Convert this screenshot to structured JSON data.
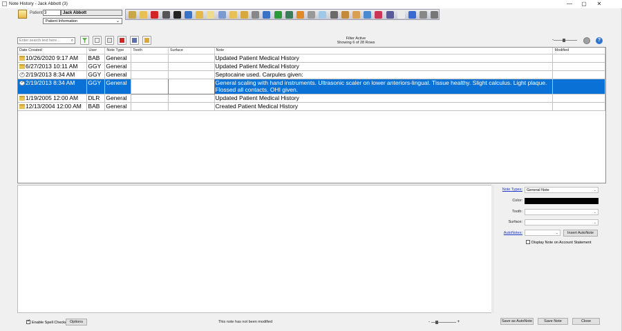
{
  "window": {
    "title": "Note History - Jack Abbott (3)",
    "min_icon": "—",
    "max_icon": "▢",
    "close_icon": "✕"
  },
  "patient": {
    "label": "Patient:",
    "number": "3",
    "name": "Jack Abbott",
    "info_select": "Patient Information"
  },
  "toolbar": {
    "icons": [
      "edit",
      "note",
      "medical-cross",
      "printer",
      "rx",
      "bottle",
      "folder",
      "envelope",
      "chart",
      "docs",
      "folder-open",
      "box",
      "stamp",
      "arrows",
      "chart2",
      "pill",
      "clipboard",
      "tooth",
      "instrument",
      "pen",
      "tool",
      "brush",
      "drawing",
      "phone",
      "camera",
      "xray",
      "wrench",
      "camera2"
    ]
  },
  "search": {
    "placeholder": "Enter search text here..."
  },
  "filter": {
    "line1": "Filter Active",
    "line2": "Showing 6 of 28 Rows"
  },
  "grid": {
    "columns": [
      "Date Created",
      "User",
      "Note Type",
      "Tooth",
      "Surface",
      "Note",
      "Modified"
    ],
    "rows": [
      {
        "icon": "folder",
        "date": "10/26/2020 9:17 AM",
        "user": "BAB",
        "type": "General",
        "tooth": "",
        "surface": "",
        "note": "Updated Patient Medical History",
        "note2": "",
        "modified": "",
        "selected": false
      },
      {
        "icon": "folder",
        "date": "6/27/2013 10:11 AM",
        "user": "GGY",
        "type": "General",
        "tooth": "",
        "surface": "",
        "note": "Updated Patient Medical History",
        "note2": "",
        "modified": "",
        "selected": false
      },
      {
        "icon": "check",
        "date": "2/19/2013 8:34 AM",
        "user": "GGY",
        "type": "General",
        "tooth": "",
        "surface": "",
        "note": "Septocaine used.  Carpules given:",
        "note2": "",
        "modified": "",
        "selected": false
      },
      {
        "icon": "check",
        "date": "2/19/2013 8:34 AM",
        "user": "GGY",
        "type": "General",
        "tooth": "",
        "surface": "",
        "note": "General scaling with hand instruments.  Ultrasonic scaler on lower anteriors-lingual.  Tissue healthy.  Slight calculus.  Light plaque.",
        "note2": "Flossed all contacts.  OHI given.",
        "modified": "",
        "selected": true
      },
      {
        "icon": "folder",
        "date": "1/19/2005 12:00 AM",
        "user": "DLR",
        "type": "General",
        "tooth": "",
        "surface": "",
        "note": "Updated Patient Medical History",
        "note2": "",
        "modified": "",
        "selected": false
      },
      {
        "icon": "folder",
        "date": "12/13/2004 12:00 AM",
        "user": "BAB",
        "type": "General",
        "tooth": "",
        "surface": "",
        "note": "Created Patient Medical History",
        "note2": "",
        "modified": "",
        "selected": false
      }
    ]
  },
  "details": {
    "note_types_label": "Note Types:",
    "note_types_value": "General Note",
    "color_label": "Color:",
    "tooth_label": "Tooth:",
    "surface_label": "Surface:",
    "autonotes_label": "AutoNotes:",
    "insert_autonote": "Insert AutoNote",
    "display_on_statement": "Display Note on Account Statement"
  },
  "bottom": {
    "spell_check": "Enable Spell Checker",
    "options": "Options",
    "status": "This note has not been modified",
    "save_autonote": "Save as AutoNote",
    "save_note": "Save Note",
    "close": "Close"
  },
  "help_icon": "?"
}
